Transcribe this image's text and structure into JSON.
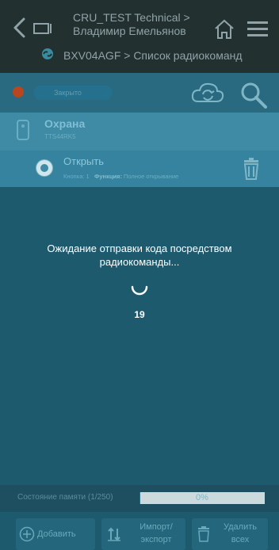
{
  "header": {
    "title_line1": "CRU_TEST Technical >",
    "title_line2": "Владимир Емельянов",
    "subtitle": "BXV04AGF > Список радиокоманд"
  },
  "toolbar": {
    "status_label": "Закрыто"
  },
  "group": {
    "title": "Охрана",
    "code": "TTS44RK5"
  },
  "command": {
    "title": "Открыть",
    "button_label": "Кнопка:",
    "button_value": "1",
    "function_label": "Функция:",
    "function_value": "Полное открывание"
  },
  "main": {
    "waiting_text": "Ожидание отправки кода посредством радиокоманды...",
    "countdown": "19"
  },
  "memory": {
    "label": "Состояние памяти (1/250)",
    "percent_text": "0%",
    "fill_fraction": 0.004
  },
  "actions": {
    "add": "Добавить",
    "import_export_1": "Импорт/",
    "import_export_2": "экспорт",
    "delete_all_1": "Удалить",
    "delete_all_2": "всех"
  },
  "colors": {
    "header_bg": "#233030",
    "toolbar_bg": "#2a6a80",
    "main_bg": "#1d5a6e",
    "status_dot": "#b9461f"
  },
  "icons": [
    "back-icon",
    "device-icon",
    "home-icon",
    "menu-icon",
    "link-icon",
    "cloud-sync-icon",
    "search-icon",
    "remote-icon",
    "trash-icon",
    "spinner-icon",
    "plus-circle-icon",
    "sort-icon"
  ]
}
